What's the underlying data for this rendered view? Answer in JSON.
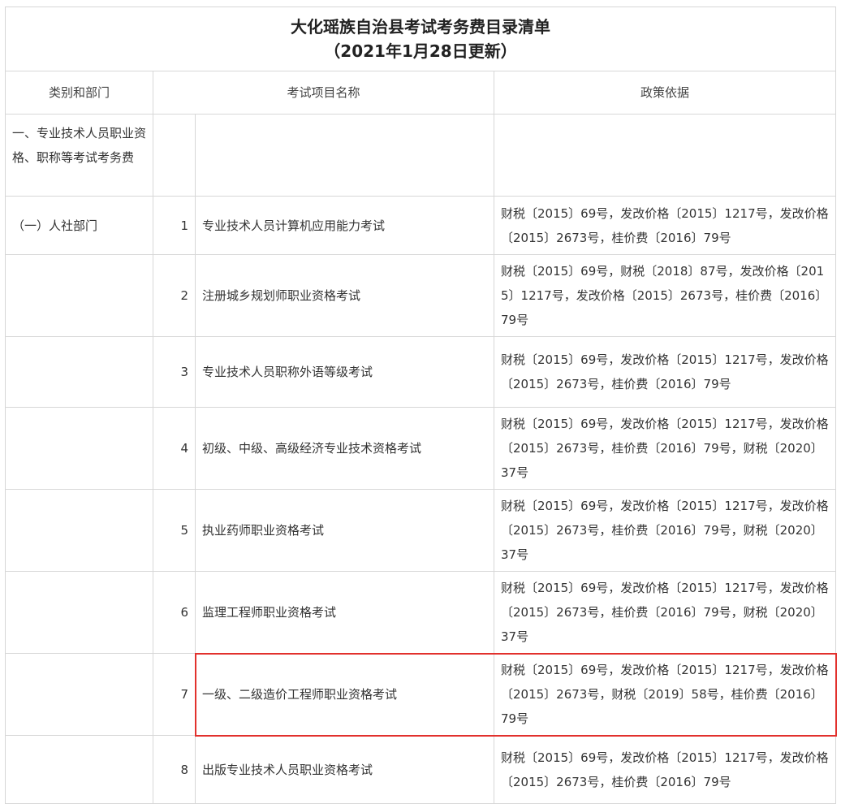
{
  "title": {
    "line1": "大化瑶族自治县考试考务费目录清单",
    "line2": "（2021年1月28日更新）"
  },
  "header": {
    "col_category": "类别和部门",
    "col_name": "考试项目名称",
    "col_basis": "政策依据"
  },
  "section": {
    "category": "一、专业技术人员职业资格、职称等考试考务费"
  },
  "rows": [
    {
      "category": "（一）人社部门",
      "num": "1",
      "name": "专业技术人员计算机应用能力考试",
      "basis": "财税〔2015〕69号，发改价格〔2015〕1217号，发改价格〔2015〕2673号，桂价费〔2016〕79号"
    },
    {
      "category": "",
      "num": "2",
      "name": "注册城乡规划师职业资格考试",
      "basis": "财税〔2015〕69号，财税〔2018〕87号，发改价格〔2015〕1217号，发改价格〔2015〕2673号，桂价费〔2016〕79号"
    },
    {
      "category": "",
      "num": "3",
      "name": "专业技术人员职称外语等级考试",
      "basis": "财税〔2015〕69号，发改价格〔2015〕1217号，发改价格〔2015〕2673号，桂价费〔2016〕79号"
    },
    {
      "category": "",
      "num": "4",
      "name": "初级、中级、高级经济专业技术资格考试",
      "basis": "财税〔2015〕69号，发改价格〔2015〕1217号，发改价格〔2015〕2673号，桂价费〔2016〕79号，财税〔2020〕37号"
    },
    {
      "category": "",
      "num": "5",
      "name": "执业药师职业资格考试",
      "basis": "财税〔2015〕69号，发改价格〔2015〕1217号，发改价格〔2015〕2673号，桂价费〔2016〕79号，财税〔2020〕37号"
    },
    {
      "category": "",
      "num": "6",
      "name": "监理工程师职业资格考试",
      "basis": "财税〔2015〕69号，发改价格〔2015〕1217号，发改价格〔2015〕2673号，桂价费〔2016〕79号，财税〔2020〕37号"
    },
    {
      "category": "",
      "num": "7",
      "name": "一级、二级造价工程师职业资格考试",
      "basis": "财税〔2015〕69号，发改价格〔2015〕1217号，发改价格〔2015〕2673号，财税〔2019〕58号，桂价费〔2016〕79号"
    },
    {
      "category": "",
      "num": "8",
      "name": "出版专业技术人员职业资格考试",
      "basis": "财税〔2015〕69号，发改价格〔2015〕1217号，发改价格〔2015〕2673号，桂价费〔2016〕79号"
    }
  ],
  "highlight": {
    "row_num": "7",
    "color": "#e2312d"
  }
}
